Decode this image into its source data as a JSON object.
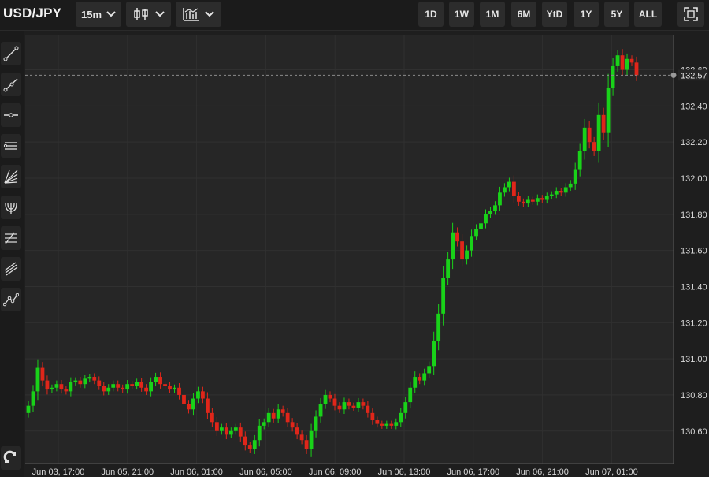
{
  "header": {
    "symbol": "USD/JPY",
    "interval": "15m",
    "chart_style_icon": "candlestick-icon",
    "indicators_icon": "indicators-icon",
    "ranges": [
      "1D",
      "1W",
      "1M",
      "6M",
      "YtD",
      "1Y",
      "5Y",
      "ALL"
    ],
    "fullscreen_icon": "fullscreen-icon"
  },
  "toolbar": {
    "tools": [
      "trend-line-icon",
      "ray-icon",
      "horizontal-line-icon",
      "parallel-channel-icon",
      "fib-fan-icon",
      "pitchfork-icon",
      "fib-retracement-icon",
      "regression-channel-icon",
      "polyline-icon"
    ],
    "magnet_icon": "magnet-icon"
  },
  "colors": {
    "up": "#19d219",
    "down": "#e0261a",
    "background": "#262626",
    "grid": "#303030",
    "axis": "#5a5a5a",
    "text": "#d9d9d9"
  },
  "chart_data": {
    "type": "candlestick",
    "symbol": "USD/JPY",
    "interval": "15m",
    "ylim": [
      130.42,
      132.79
    ],
    "y_ticks": [
      130.6,
      130.8,
      131.0,
      131.2,
      131.4,
      131.6,
      131.8,
      132.0,
      132.2,
      132.4,
      132.6
    ],
    "y_tick_labels": [
      "130.60",
      "130.80",
      "131.00",
      "131.20",
      "131.40",
      "131.60",
      "131.80",
      "132.00",
      "132.20",
      "132.40",
      "132.60"
    ],
    "x_tick_labels": [
      "Jun 03, 17:00",
      "Jun 05, 21:00",
      "Jun 06, 01:00",
      "Jun 06, 05:00",
      "Jun 06, 09:00",
      "Jun 06, 13:00",
      "Jun 06, 17:00",
      "Jun 06, 21:00",
      "Jun 07, 01:00"
    ],
    "last_price": 132.57,
    "last_price_label": "132.57",
    "grid": true,
    "closes": [
      130.74,
      130.82,
      130.95,
      130.88,
      130.83,
      130.84,
      130.86,
      130.83,
      130.82,
      130.87,
      130.88,
      130.86,
      130.89,
      130.9,
      130.88,
      130.85,
      130.82,
      130.84,
      130.86,
      130.84,
      130.83,
      130.86,
      130.85,
      130.87,
      130.84,
      130.82,
      130.87,
      130.9,
      130.86,
      130.85,
      130.83,
      130.84,
      130.8,
      130.75,
      130.72,
      130.78,
      130.82,
      130.78,
      130.7,
      130.65,
      130.6,
      130.62,
      130.58,
      130.6,
      130.62,
      130.57,
      130.52,
      130.5,
      130.55,
      130.63,
      130.65,
      130.7,
      130.67,
      130.72,
      130.7,
      130.65,
      130.62,
      130.58,
      130.55,
      130.5,
      130.6,
      130.68,
      130.75,
      130.8,
      130.78,
      130.74,
      130.72,
      130.76,
      130.74,
      130.73,
      130.76,
      130.74,
      130.7,
      130.66,
      130.64,
      130.63,
      130.64,
      130.63,
      130.65,
      130.7,
      130.76,
      130.84,
      130.9,
      130.88,
      130.92,
      130.96,
      131.1,
      131.25,
      131.45,
      131.55,
      131.7,
      131.65,
      131.55,
      131.6,
      131.68,
      131.72,
      131.75,
      131.8,
      131.82,
      131.85,
      131.92,
      131.95,
      131.98,
      131.9,
      131.87,
      131.86,
      131.88,
      131.87,
      131.89,
      131.88,
      131.9,
      131.91,
      131.93,
      131.92,
      131.95,
      131.97,
      132.05,
      132.15,
      132.28,
      132.2,
      132.15,
      132.35,
      132.25,
      132.5,
      132.62,
      132.68,
      132.6,
      132.66,
      132.64,
      132.57
    ]
  }
}
